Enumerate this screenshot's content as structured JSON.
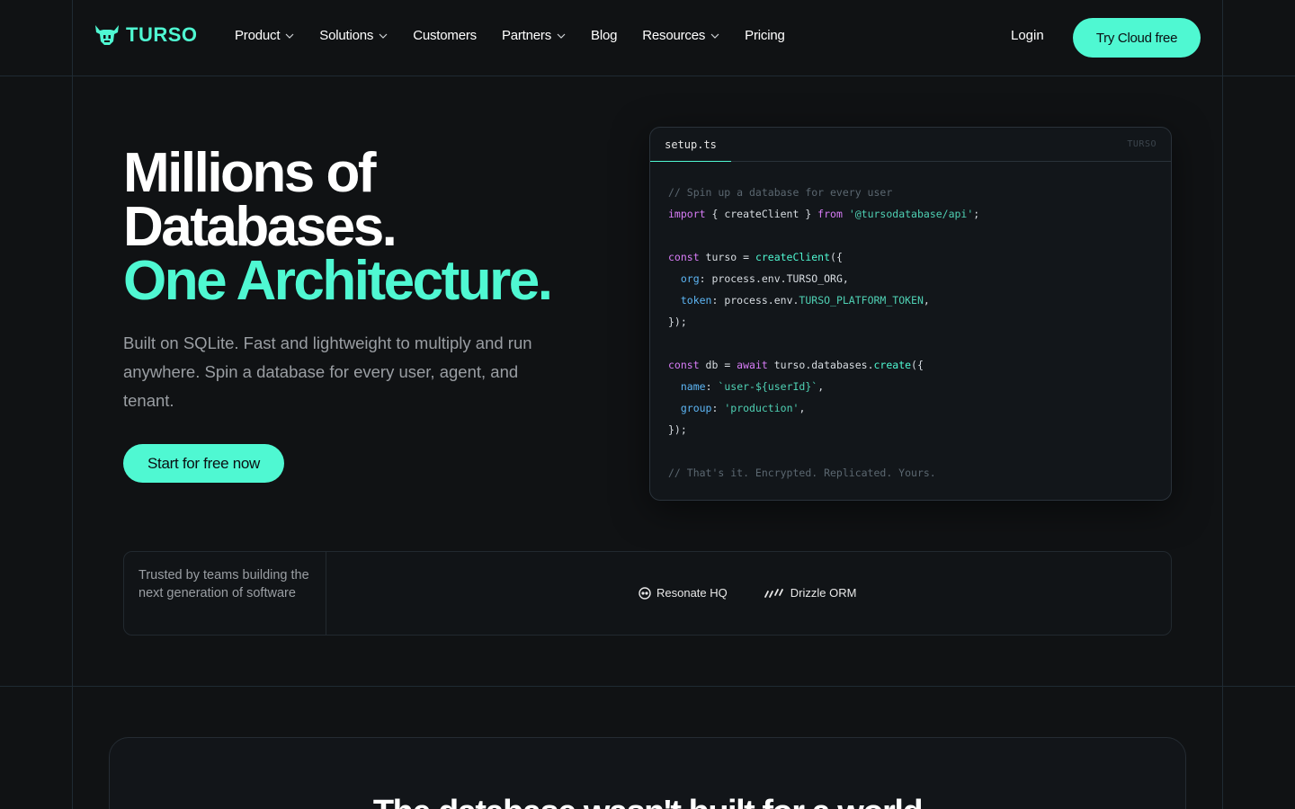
{
  "brand": {
    "name": "TURSO",
    "accent_color": "#4ff8d2",
    "icon": "bull-head-icon"
  },
  "nav": {
    "items": [
      {
        "label": "Product",
        "dropdown": true
      },
      {
        "label": "Solutions",
        "dropdown": true
      },
      {
        "label": "Customers",
        "dropdown": false
      },
      {
        "label": "Partners",
        "dropdown": true
      },
      {
        "label": "Blog",
        "dropdown": false
      },
      {
        "label": "Resources",
        "dropdown": true
      },
      {
        "label": "Pricing",
        "dropdown": false
      }
    ],
    "login_label": "Login",
    "cta_label": "Try Cloud free"
  },
  "hero": {
    "title_line1": "Millions of",
    "title_line2": "Databases.",
    "title_line3": "One Architecture.",
    "subtitle": "Built on SQLite. Fast and lightweight to multiply and run anywhere. Spin a database for every user, agent, and tenant.",
    "cta_label": "Start for free now"
  },
  "code": {
    "tab_label": "setup.ts",
    "brand_label": "TURSO",
    "lines": {
      "l1": "// Spin up a database for every user",
      "l2_kw": "import",
      "l2_mid": " { createClient } ",
      "l2_from": "from",
      "l2_str": "'@tursodatabase/api'",
      "l2_end": ";",
      "l4_kw": "const",
      "l4_mid": " turso = ",
      "l4_fn": "createClient",
      "l4_end": "({",
      "l5_prop": "org",
      "l5_rest": ": process.env.TURSO_ORG,",
      "l6_prop": "token",
      "l6_mid": ": process.env.",
      "l6_env": "TURSO_PLATFORM_TOKEN",
      "l6_end": ",",
      "l7": "});",
      "l9_kw": "const",
      "l9_mid": " db = ",
      "l9_await": "await",
      "l9_mid2": " turso.databases.",
      "l9_fn": "create",
      "l9_end": "({",
      "l10_prop": "name",
      "l10_sep": ": ",
      "l10_str": "`user-${userId}`",
      "l10_end": ",",
      "l11_prop": "group",
      "l11_sep": ": ",
      "l11_str": "'production'",
      "l11_end": ",",
      "l12": "});",
      "l14": "// That's it. Encrypted. Replicated. Yours."
    }
  },
  "trusted": {
    "label": "Trusted by teams building the next generation of software",
    "logos": [
      {
        "name": "Resonate HQ",
        "icon": "resonate-icon"
      },
      {
        "name": "Drizzle ORM",
        "icon": "drizzle-icon"
      }
    ]
  },
  "section2": {
    "title": "The database wasn't built for a world"
  }
}
